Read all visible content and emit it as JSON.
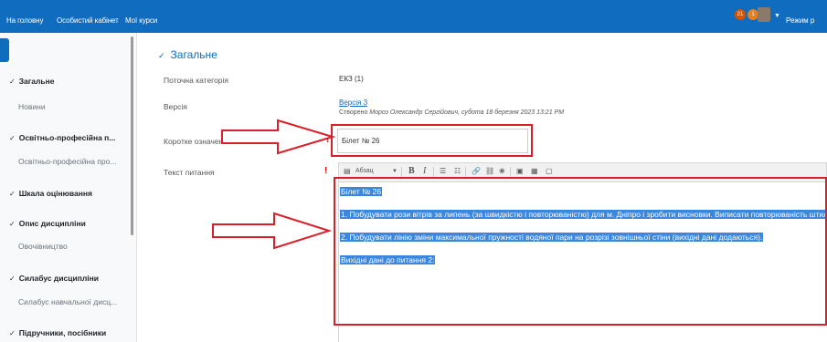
{
  "navbar": {
    "links": [
      "На головну",
      "Особистий кабінет",
      "Мої курси"
    ],
    "notifications_count": "21",
    "messages_count": "1",
    "mode_text": "Режим р"
  },
  "sidebar": {
    "items": [
      {
        "type": "section",
        "label": "Загальне"
      },
      {
        "type": "item",
        "label": "Новини"
      },
      {
        "type": "section",
        "label": "Освітньо-професійна п..."
      },
      {
        "type": "item",
        "label": "Освітньо-професійна про..."
      },
      {
        "type": "section",
        "label": "Шкала оцінювання"
      },
      {
        "type": "section",
        "label": "Опис дисципліни"
      },
      {
        "type": "item",
        "label": "Овочівництво"
      },
      {
        "type": "section",
        "label": "Силабус дисципліни"
      },
      {
        "type": "item",
        "label": "Силабус навчальної дисц..."
      },
      {
        "type": "section",
        "label": "Підручники, посібники"
      }
    ]
  },
  "main": {
    "section_title": "Загальне",
    "fields": {
      "category_label": "Поточна категорія",
      "category_value": "ЕКЗ (1)",
      "version_label": "Версія",
      "version_link": "Версія 3",
      "version_meta_prefix": "Створено",
      "version_meta_author": "Мороз Олександр Сергійович, субота 18 березня 2023 13:21 PM",
      "short_name_label": "Коротке означення питання",
      "short_name_value": "Білет № 26",
      "question_text_label": "Текст питання"
    },
    "editor": {
      "paragraph_format": "Абзац",
      "lines": [
        "Білет № 26",
        "1. Побудувати рози вітрів за липень (за швидкістю і повторюваністю) для м. Дніпро і зробити висновки. Виписати повторюваність штилів.",
        "2. Побудувати лінію зміни максимальної пружності водяної пари на розрізі зовнішньої стіни (вихідні дані додаються).",
        "Вихідні дані до питання 2:"
      ]
    }
  },
  "colors": {
    "brand": "#0f6cbf",
    "annotation_red": "#d9202a",
    "selection": "#3b87e0"
  }
}
